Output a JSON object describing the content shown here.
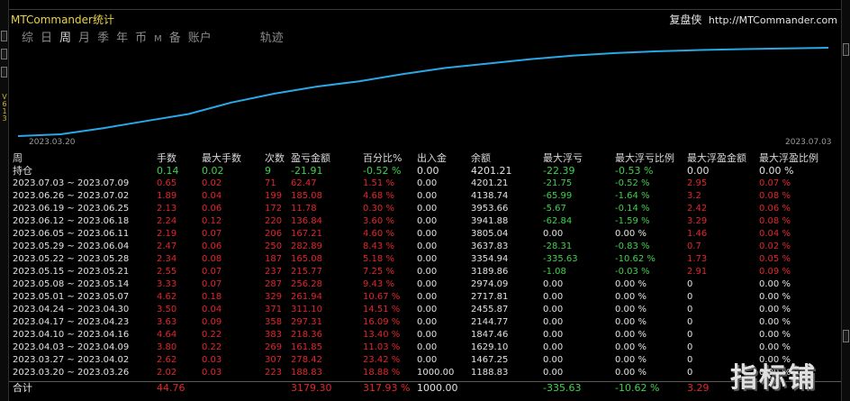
{
  "header": {
    "title": "MTCommander统计",
    "brand": "复盘侠",
    "url": "http://MTCommander.com"
  },
  "side": {
    "left_label": "V 6 1 3"
  },
  "tabs": [
    {
      "label": "综",
      "active": false
    },
    {
      "label": "日",
      "active": false
    },
    {
      "label": "周",
      "active": true
    },
    {
      "label": "月",
      "active": false
    },
    {
      "label": "季",
      "active": false
    },
    {
      "label": "年",
      "active": false
    },
    {
      "label": "币",
      "active": false
    },
    {
      "label": "M",
      "active": false
    },
    {
      "label": "备",
      "active": false
    },
    {
      "label": "账户",
      "active": false
    },
    {
      "label": "",
      "active": false
    },
    {
      "label": "轨迹",
      "active": false
    }
  ],
  "chart_data": {
    "type": "line",
    "x_start": "2023.03.20",
    "x_end": "2023.07.03",
    "line_color": "#2aa8e6",
    "points": [
      0.0,
      0.02,
      0.09,
      0.17,
      0.25,
      0.38,
      0.48,
      0.56,
      0.62,
      0.7,
      0.77,
      0.82,
      0.87,
      0.91,
      0.94,
      0.96,
      0.975,
      0.985,
      0.992,
      1.0
    ]
  },
  "table": {
    "columns": [
      "周",
      "手数",
      "最大手数",
      "次数",
      "盈亏金额",
      "百分比%",
      "出入金",
      "余额",
      "最大浮亏",
      "最大浮亏比例",
      "最大浮盈金额",
      "最大浮盈比例"
    ],
    "holding": [
      "持仓",
      "0.14",
      "0.02",
      "9",
      "-21.91",
      "-0.52 %",
      "0.00",
      "4201.21",
      "-22.39",
      "-0.53 %",
      "0.00",
      "0.00 %"
    ],
    "rows": [
      [
        "2023.07.03 ~ 2023.07.09",
        "0.65",
        "0.02",
        "71",
        "62.47",
        "1.51 %",
        "0.00",
        "4201.21",
        "-21.75",
        "-0.52 %",
        "2.95",
        "0.07 %"
      ],
      [
        "2023.06.26 ~ 2023.07.02",
        "1.89",
        "0.04",
        "199",
        "185.08",
        "4.68 %",
        "0.00",
        "4138.74",
        "-65.99",
        "-1.64 %",
        "3.2",
        "0.08 %"
      ],
      [
        "2023.06.19 ~ 2023.06.25",
        "2.13",
        "0.06",
        "172",
        "11.78",
        "0.30 %",
        "0.00",
        "3953.66",
        "-5.67",
        "-0.14 %",
        "2.42",
        "0.06 %"
      ],
      [
        "2023.06.12 ~ 2023.06.18",
        "2.24",
        "0.12",
        "220",
        "136.84",
        "3.60 %",
        "0.00",
        "3941.88",
        "-62.84",
        "-1.59 %",
        "3.29",
        "0.08 %"
      ],
      [
        "2023.06.05 ~ 2023.06.11",
        "2.19",
        "0.07",
        "206",
        "167.21",
        "4.60 %",
        "0.00",
        "3805.04",
        "0.00",
        "0.00 %",
        "1.46",
        "0.04 %"
      ],
      [
        "2023.05.29 ~ 2023.06.04",
        "2.47",
        "0.06",
        "250",
        "282.89",
        "8.43 %",
        "0.00",
        "3637.83",
        "-28.31",
        "-0.83 %",
        "0.7",
        "0.02 %"
      ],
      [
        "2023.05.22 ~ 2023.05.28",
        "2.34",
        "0.08",
        "187",
        "165.08",
        "5.18 %",
        "0.00",
        "3354.94",
        "-335.63",
        "-10.62 %",
        "1.73",
        "0.05 %"
      ],
      [
        "2023.05.15 ~ 2023.05.21",
        "2.55",
        "0.07",
        "237",
        "215.77",
        "7.25 %",
        "0.00",
        "3189.86",
        "-1.08",
        "-0.03 %",
        "2.91",
        "0.09 %"
      ],
      [
        "2023.05.08 ~ 2023.05.14",
        "3.33",
        "0.07",
        "287",
        "256.28",
        "9.43 %",
        "0.00",
        "2974.09",
        "0.00",
        "0.00 %",
        "0",
        "0.00 %"
      ],
      [
        "2023.05.01 ~ 2023.05.07",
        "4.62",
        "0.18",
        "329",
        "261.94",
        "10.67 %",
        "0.00",
        "2717.81",
        "0.00",
        "0.00 %",
        "0",
        "0.00 %"
      ],
      [
        "2023.04.24 ~ 2023.04.30",
        "3.50",
        "0.04",
        "371",
        "311.10",
        "14.51 %",
        "0.00",
        "2455.87",
        "0.00",
        "0.00 %",
        "0",
        "0.00 %"
      ],
      [
        "2023.04.17 ~ 2023.04.23",
        "3.63",
        "0.09",
        "358",
        "297.31",
        "16.09 %",
        "0.00",
        "2144.77",
        "0.00",
        "0.00 %",
        "0",
        "0.00 %"
      ],
      [
        "2023.04.10 ~ 2023.04.16",
        "4.64",
        "0.22",
        "383",
        "218.36",
        "13.40 %",
        "0.00",
        "1847.46",
        "0.00",
        "0.00 %",
        "0",
        "0.00 %"
      ],
      [
        "2023.04.03 ~ 2023.04.09",
        "3.80",
        "0.22",
        "269",
        "161.85",
        "11.03 %",
        "0.00",
        "1629.10",
        "0.00",
        "0.00 %",
        "0",
        "0.00 %"
      ],
      [
        "2023.03.27 ~ 2023.04.02",
        "2.62",
        "0.03",
        "307",
        "278.42",
        "23.42 %",
        "0.00",
        "1467.25",
        "0.00",
        "0.00 %",
        "0",
        "0.00 %"
      ],
      [
        "2023.03.20 ~ 2023.03.26",
        "2.02",
        "0.03",
        "223",
        "188.83",
        "18.88 %",
        "1000.00",
        "1188.83",
        "0.00",
        "0.00 %",
        "0",
        "0.00 %"
      ]
    ],
    "total": [
      "合计",
      "44.76",
      "",
      "",
      "3179.30",
      "317.93 %",
      "1000.00",
      "",
      "-335.63",
      "-10.62 %",
      "3.29",
      ""
    ]
  },
  "watermark": "指标铺"
}
